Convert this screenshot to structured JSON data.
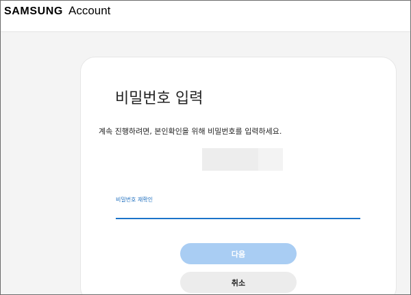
{
  "header": {
    "brand_logo": "SAMSUNG",
    "brand_product": "Account"
  },
  "dialog": {
    "title": "비밀번호 입력",
    "description": "계속 진행하려면, 본인확인을 위해 비밀번호를 입력하세요.",
    "password_field": {
      "label": "비밀번호 재확인",
      "value": "",
      "placeholder": ""
    },
    "next_button_label": "다음",
    "cancel_button_label": "취소"
  },
  "colors": {
    "accent": "#1a73c9",
    "next_button_disabled": "#a9cdf3",
    "cancel_button": "#ececec",
    "page_background": "#f4f4f4"
  }
}
